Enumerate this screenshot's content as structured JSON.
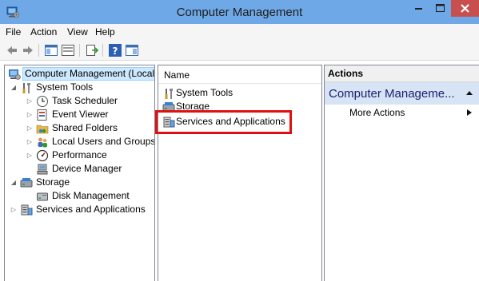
{
  "window": {
    "title": "Computer Management",
    "icon": "computer-management-icon",
    "controls": {
      "minimize_icon": "minimize-icon",
      "maximize_icon": "maximize-icon",
      "close_icon": "close-icon",
      "close_color": "#c7504f"
    },
    "accent_color": "#6ea8e6"
  },
  "menu": [
    "File",
    "Action",
    "View",
    "Help"
  ],
  "toolbar": {
    "buttons": [
      "back-icon",
      "forward-icon",
      "show-hide-console-tree-icon",
      "export-list-icon",
      "help-icon",
      "show-hide-action-pane-icon"
    ]
  },
  "tree": [
    {
      "label": "Computer Management (Local",
      "icon": "computer-management-icon",
      "selected": true
    },
    {
      "label": "System Tools",
      "icon": "tools-icon",
      "expanded": true
    },
    {
      "label": "Task Scheduler",
      "icon": "clock-icon"
    },
    {
      "label": "Event Viewer",
      "icon": "event-viewer-icon"
    },
    {
      "label": "Shared Folders",
      "icon": "shared-folder-icon"
    },
    {
      "label": "Local Users and Groups",
      "icon": "users-icon"
    },
    {
      "label": "Performance",
      "icon": "performance-icon"
    },
    {
      "label": "Device Manager",
      "icon": "device-manager-icon"
    },
    {
      "label": "Storage",
      "icon": "storage-icon",
      "expanded": true
    },
    {
      "label": "Disk Management",
      "icon": "disk-icon"
    },
    {
      "label": "Services and Applications",
      "icon": "services-icon"
    }
  ],
  "list": {
    "column_header": "Name",
    "items": [
      {
        "label": "System Tools",
        "icon": "tools-icon"
      },
      {
        "label": "Storage",
        "icon": "storage-icon"
      },
      {
        "label": "Services and Applications",
        "icon": "services-icon",
        "highlighted": true
      }
    ],
    "highlight_color": "#e01010"
  },
  "actions": {
    "header": "Actions",
    "section_title": "Computer Manageme...",
    "items": [
      "More Actions"
    ],
    "section_color": "#d6e4f5"
  }
}
